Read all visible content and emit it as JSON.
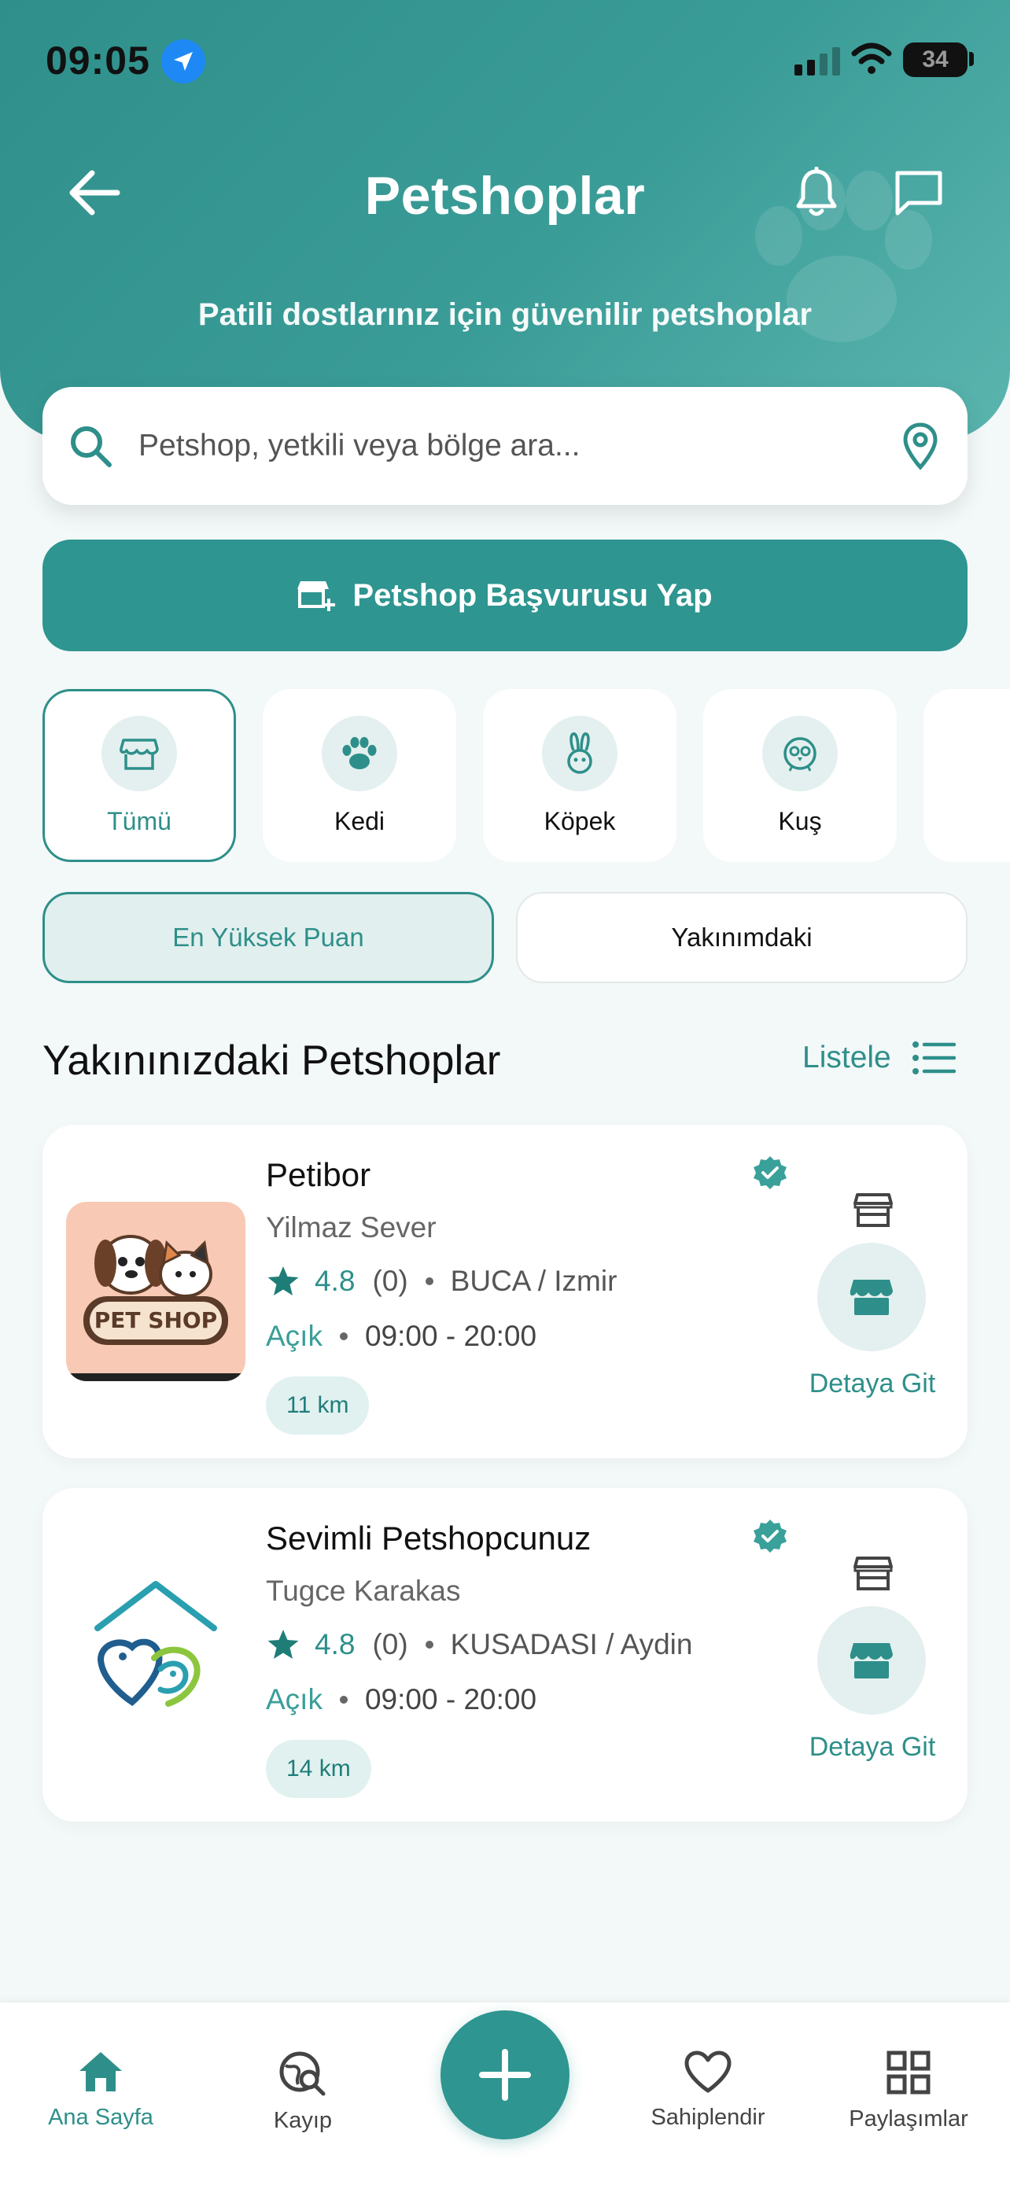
{
  "status_bar": {
    "time": "09:05",
    "battery": "34"
  },
  "header": {
    "title": "Petshoplar",
    "subtitle": "Patili dostlarınız için güvenilir petshoplar"
  },
  "search": {
    "placeholder": "Petshop, yetkili veya bölge ara..."
  },
  "apply_button": {
    "label": "Petshop Başvurusu Yap"
  },
  "categories": [
    {
      "label": "Tümü",
      "icon": "store-icon",
      "active": true
    },
    {
      "label": "Kedi",
      "icon": "paw-icon",
      "active": false
    },
    {
      "label": "Köpek",
      "icon": "rabbit-icon",
      "active": false
    },
    {
      "label": "Kuş",
      "icon": "bird-icon",
      "active": false
    }
  ],
  "sort_options": [
    {
      "label": "En Yüksek Puan",
      "active": true
    },
    {
      "label": "Yakınımdaki",
      "active": false
    }
  ],
  "section": {
    "title": "Yakınınızdaki Petshoplar",
    "list_label": "Listele"
  },
  "shops": [
    {
      "name": "Petibor",
      "owner": "Yilmaz Sever",
      "rating": "4.8",
      "reviews": "(0)",
      "location": "BUCA / Izmir",
      "status": "Açık",
      "hours": "09:00 - 20:00",
      "distance": "11 km",
      "detail_label": "Detaya Git",
      "logo_text": "PET SHOP"
    },
    {
      "name": "Sevimli Petshopcunuz",
      "owner": "Tugce Karakas",
      "rating": "4.8",
      "reviews": "(0)",
      "location": "KUSADASI / Aydin",
      "status": "Açık",
      "hours": "09:00 - 20:00",
      "distance": "14 km",
      "detail_label": "Detaya Git"
    }
  ],
  "bottom_nav": [
    {
      "label": "Ana Sayfa",
      "icon": "home-icon",
      "active": true
    },
    {
      "label": "Kayıp",
      "icon": "globe-search-icon",
      "active": false
    },
    {
      "label": "",
      "icon": "plus-icon",
      "active": false
    },
    {
      "label": "Sahiplendir",
      "icon": "heart-icon",
      "active": false
    },
    {
      "label": "Paylaşımlar",
      "icon": "grid-icon",
      "active": false
    }
  ],
  "colors": {
    "primary": "#2E9590",
    "header_light": "#5BB5AF",
    "background": "#F3F8F8",
    "accent_text": "#2E8F8A"
  }
}
